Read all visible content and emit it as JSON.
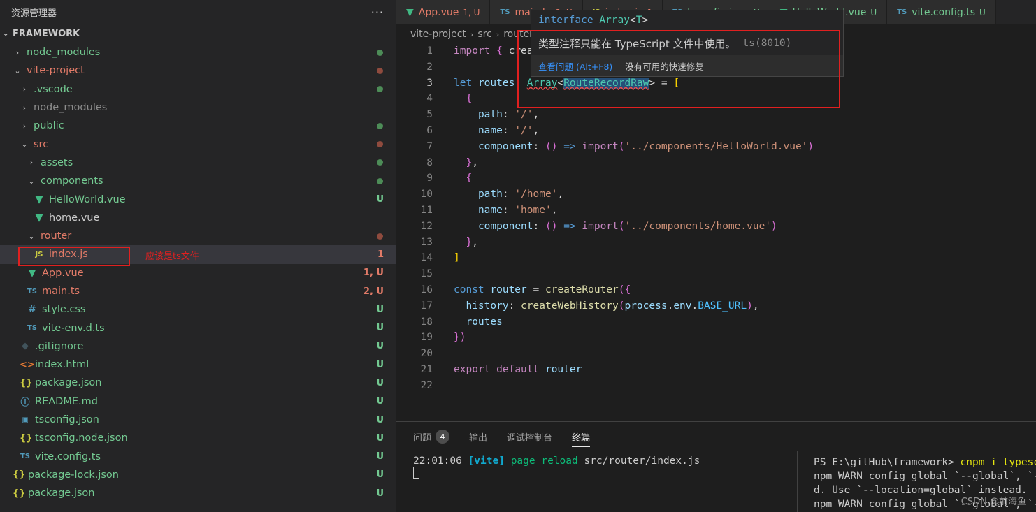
{
  "sidebar": {
    "title": "资源管理器",
    "more": "···",
    "section": "FRAMEWORK",
    "items": [
      {
        "label": "node_modules",
        "indent": 1,
        "chev": "›",
        "color": "green",
        "dot": "#4d8c57"
      },
      {
        "label": "vite-project",
        "indent": 1,
        "chev": "⌄",
        "color": "red",
        "dot": "#8f4b3e"
      },
      {
        "label": ".vscode",
        "indent": 2,
        "chev": "›",
        "color": "green",
        "dot": "#4d8c57"
      },
      {
        "label": "node_modules",
        "indent": 2,
        "chev": "›",
        "color": "gray"
      },
      {
        "label": "public",
        "indent": 2,
        "chev": "›",
        "color": "green",
        "dot": "#4d8c57"
      },
      {
        "label": "src",
        "indent": 2,
        "chev": "⌄",
        "color": "red",
        "dot": "#8f4b3e"
      },
      {
        "label": "assets",
        "indent": 3,
        "chev": "›",
        "color": "green",
        "dot": "#4d8c57"
      },
      {
        "label": "components",
        "indent": 3,
        "chev": "⌄",
        "color": "green",
        "dot": "#4d8c57"
      },
      {
        "label": "HelloWorld.vue",
        "indent": 4,
        "icon": "vue",
        "color": "green",
        "badge": "U"
      },
      {
        "label": "home.vue",
        "indent": 4,
        "icon": "vue",
        "color": "white"
      },
      {
        "label": "router",
        "indent": 3,
        "chev": "⌄",
        "color": "red",
        "dot": "#8f4b3e"
      },
      {
        "label": "index.js",
        "indent": 4,
        "icon": "js",
        "color": "red",
        "badge": "1",
        "selected": true
      },
      {
        "label": "App.vue",
        "indent": 3,
        "icon": "vue",
        "color": "red",
        "badge": "1, U"
      },
      {
        "label": "main.ts",
        "indent": 3,
        "icon": "ts",
        "color": "red",
        "badge": "2, U"
      },
      {
        "label": "style.css",
        "indent": 3,
        "icon": "css",
        "color": "green",
        "badge": "U"
      },
      {
        "label": "vite-env.d.ts",
        "indent": 3,
        "icon": "ts",
        "color": "green",
        "badge": "U"
      },
      {
        "label": ".gitignore",
        "indent": 2,
        "icon": "git",
        "color": "green",
        "badge": "U"
      },
      {
        "label": "index.html",
        "indent": 2,
        "icon": "html",
        "color": "green",
        "badge": "U"
      },
      {
        "label": "package.json",
        "indent": 2,
        "icon": "json",
        "color": "green",
        "badge": "U"
      },
      {
        "label": "README.md",
        "indent": 2,
        "icon": "info",
        "color": "green",
        "badge": "U"
      },
      {
        "label": "tsconfig.json",
        "indent": 2,
        "icon": "tsconfig",
        "color": "green",
        "badge": "U"
      },
      {
        "label": "tsconfig.node.json",
        "indent": 2,
        "icon": "json",
        "color": "green",
        "badge": "U"
      },
      {
        "label": "vite.config.ts",
        "indent": 2,
        "icon": "ts",
        "color": "green",
        "badge": "U"
      },
      {
        "label": "package-lock.json",
        "indent": 1,
        "icon": "json",
        "color": "green",
        "badge": "U"
      },
      {
        "label": "package.json",
        "indent": 1,
        "icon": "json",
        "color": "green",
        "badge": "U"
      }
    ],
    "annotation": "应该是ts文件"
  },
  "tabs": [
    {
      "label": "App.vue",
      "status": "1, U",
      "icon": "vue",
      "color": "#e27b68"
    },
    {
      "label": "main.ts",
      "status": "2, U",
      "icon": "ts",
      "color": "#e27b68"
    },
    {
      "label": "index.js",
      "status": "1",
      "icon": "js",
      "color": "#e27b68"
    },
    {
      "label": "tsconfig.json",
      "status": "U",
      "icon": "ts",
      "color": "#73c991"
    },
    {
      "label": "HelloWorld.vue",
      "status": "U",
      "icon": "vue",
      "color": "#73c991"
    },
    {
      "label": "vite.config.ts",
      "status": "U",
      "icon": "ts",
      "color": "#73c991"
    }
  ],
  "breadcrumb": [
    "vite-project",
    "src",
    "router",
    "index.js"
  ],
  "code_lines": [
    "import { createRouter, createWebHistory } from 'vue-router'",
    "",
    "let routes: Array<RouteRecordRaw> = [",
    "  {",
    "    path: '/',",
    "    name: '/',",
    "    component: () => import('../components/HelloWorld.vue')",
    "  },",
    "  {",
    "    path: '/home',",
    "    name: 'home',",
    "    component: () => import('../components/home.vue')",
    "  },",
    "]",
    "",
    "const router = createRouter({",
    "  history: createWebHistory(process.env.BASE_URL),",
    "  routes",
    "})",
    "",
    "export default router",
    ""
  ],
  "hover": {
    "signature": "interface Array<T>",
    "message": "类型注释只能在 TypeScript 文件中使用。",
    "code": "ts(8010)",
    "action_link": "查看问题 (Alt+F8)",
    "action_text": "没有可用的快速修复"
  },
  "panel": {
    "tabs": [
      {
        "label": "问题",
        "badge": "4"
      },
      {
        "label": "输出"
      },
      {
        "label": "调试控制台"
      },
      {
        "label": "终端",
        "active": true
      }
    ],
    "terminal_left": {
      "time": "22:01:06",
      "tag": "[vite]",
      "msg": "page reload",
      "path": "src/router/index.js"
    },
    "terminal_right": [
      "PS E:\\gitHub\\framework> cnpm i typescript",
      "npm WARN config global `--global`, `--local` are deprecate",
      "d. Use `--location=global` instead.",
      "npm WARN config global `--global`, `--local` are deprecate"
    ],
    "terminal_right_cmd": "cnpm i typescript",
    "watermark": "CSDN @前海鱼"
  }
}
